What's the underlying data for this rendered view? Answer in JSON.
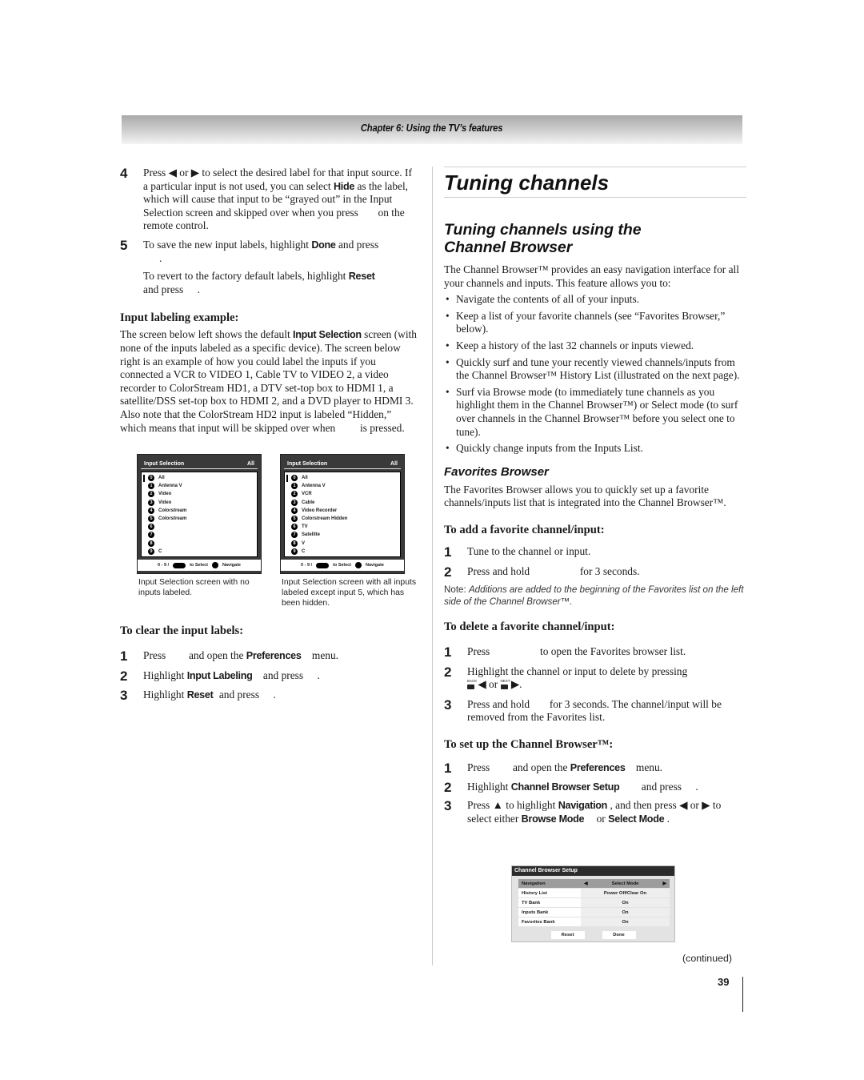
{
  "header": {
    "chapter": "Chapter 6: Using the TV’s features"
  },
  "left": {
    "step4": {
      "num": "4",
      "t1": "Press ◀ or ▶ to select the desired label for that input source. If a particular input is not used, you can select ",
      "hide": "Hide",
      "t2": " as the label, which will cause that input to be “grayed out” in the Input Selection screen and skipped over when you press ",
      "t3": " on the remote control."
    },
    "step5": {
      "num": "5",
      "t1": "To save the new input labels, highlight ",
      "done": "Done",
      "t2": " and press",
      "t3": ".",
      "revert1": "To revert to the factory default labels, highlight ",
      "reset": "Reset",
      "revert2": " and press ",
      "revert3": "."
    },
    "example": {
      "heading": "Input labeling example:",
      "t1": "The screen below left shows the default ",
      "bold": "Input Selection",
      "t2": " screen (with none of the inputs labeled as a specific device). The screen below right is an example of how you could label the inputs if you connected a VCR to VIDEO 1, Cable TV to VIDEO 2, a video recorder to ColorStream HD1, a DTV set-top box to HDMI 1, a satellite/DSS set-top box to HDMI 2, and a DVD player to HDMI 3. Also note that the ColorStream HD2 input is labeled “Hidden,” which means that input will be skipped over when ",
      "t3": " is pressed."
    },
    "screen_left": {
      "title": "Input Selection",
      "corner": "All",
      "items": [
        {
          "n": "0",
          "label": "All"
        },
        {
          "n": "1",
          "label": "Antenna V"
        },
        {
          "n": "2",
          "label": "Video"
        },
        {
          "n": "3",
          "label": "Video"
        },
        {
          "n": "4",
          "label": "Colorstream"
        },
        {
          "n": "5",
          "label": "Colorstream"
        },
        {
          "n": "6",
          "label": ""
        },
        {
          "n": "7",
          "label": ""
        },
        {
          "n": "8",
          "label": ""
        },
        {
          "n": "9",
          "label": "C"
        }
      ],
      "foot_range": "0 - 9 /",
      "foot_select": "to Select",
      "foot_nav": "Navigate",
      "caption": "Input Selection screen with no inputs labeled."
    },
    "screen_right": {
      "title": "Input Selection",
      "corner": "All",
      "items": [
        {
          "n": "0",
          "label": "All"
        },
        {
          "n": "1",
          "label": "Antenna V"
        },
        {
          "n": "2",
          "label": "VCR"
        },
        {
          "n": "3",
          "label": "Cable"
        },
        {
          "n": "4",
          "label": "Video Recorder"
        },
        {
          "n": "5",
          "label": "Colorstream Hidden"
        },
        {
          "n": "6",
          "label": "TV"
        },
        {
          "n": "7",
          "label": "Satellite"
        },
        {
          "n": "8",
          "label": "V"
        },
        {
          "n": "9",
          "label": "C"
        }
      ],
      "foot_range": "0 - 9 /",
      "foot_select": "to Select",
      "foot_nav": "Navigate",
      "caption": "Input Selection screen with all inputs labeled except input 5, which has been hidden."
    },
    "clear": {
      "heading": "To clear the input labels:",
      "s1": {
        "num": "1",
        "t1": "Press ",
        "t2": " and open the ",
        "b": "Preferences",
        "t3": " menu."
      },
      "s2": {
        "num": "2",
        "t1": "Highlight ",
        "b": "Input Labeling",
        "t2": " and press ",
        "t3": "."
      },
      "s3": {
        "num": "3",
        "t1": "Highlight ",
        "b": "Reset",
        "t2": " and press ",
        "t3": "."
      }
    }
  },
  "right": {
    "title": "Tuning channels",
    "subtitle": "Tuning channels using the Channel Browser",
    "intro": "The Channel Browser™ provides an easy navigation interface for all your channels and inputs. This feature allows you to:",
    "bullets": [
      "Navigate the contents of all of your inputs.",
      "Keep a list of your favorite channels (see “Favorites Browser,” below).",
      "Keep a history of the last 32 channels or inputs viewed.",
      "Quickly surf and tune your recently viewed channels/inputs from the Channel Browser™ History List (illustrated on the next page).",
      "Surf via Browse mode (to immediately tune channels as you highlight them in the Channel Browser™) or Select mode (to surf over channels in the Channel Browser™ before you select one to tune).",
      "Quickly change inputs from the Inputs List."
    ],
    "fav": {
      "heading": "Favorites Browser",
      "text": "The Favorites Browser allows you to quickly set up a favorite channels/inputs list that is integrated into the Channel Browser™."
    },
    "add": {
      "heading": "To add a favorite channel/input:",
      "s1": {
        "num": "1",
        "text": "Tune to the channel or input."
      },
      "s2": {
        "num": "2",
        "t1": "Press and hold ",
        "t2": " for 3 seconds."
      },
      "note_label": "Note: ",
      "note": "Additions are added to the beginning of the Favorites list on the left side of the Channel Browser™."
    },
    "del": {
      "heading": "To delete a favorite channel/input:",
      "s1": {
        "num": "1",
        "t1": "Press ",
        "t2": " to open the Favorites browser list."
      },
      "s2": {
        "num": "2",
        "t1": "Highlight the channel or input to delete by pressing",
        "back": "BACK",
        "or": " ◀ or ",
        "next": "NEXT",
        "end": " ▶."
      },
      "s3": {
        "num": "3",
        "t1": "Press and hold ",
        "t2": " for 3 seconds. The channel/input will be removed from the Favorites list."
      }
    },
    "setup": {
      "heading": "To set up the Channel Browser™:",
      "s1": {
        "num": "1",
        "t1": "Press ",
        "t2": " and open the ",
        "b": "Preferences",
        "t3": " menu."
      },
      "s2": {
        "num": "2",
        "t1": "Highlight ",
        "b": "Channel Browser Setup",
        "t2": " and press ",
        "t3": "."
      },
      "s3": {
        "num": "3",
        "t1": "Press ▲ to highlight ",
        "b1": "Navigation",
        "t2": " , and then press ◀ or ▶ to select either ",
        "b2": "Browse Mode",
        "t3": " or ",
        "b3": "Select Mode",
        "t4": " ."
      }
    },
    "cbs_screen": {
      "title": "Channel Browser Setup",
      "rows": [
        {
          "key": "Navigation",
          "value": "Select Mode",
          "selected": true
        },
        {
          "key": "History List",
          "value": "Power Off/Clear On"
        },
        {
          "key": "TV Bank",
          "value": "On"
        },
        {
          "key": "Inputs Bank",
          "value": "On"
        },
        {
          "key": "Favorites Bank",
          "value": "On"
        }
      ],
      "reset": "Reset",
      "done": "Done"
    }
  },
  "footer": {
    "continued": "(continued)",
    "page": "39"
  }
}
